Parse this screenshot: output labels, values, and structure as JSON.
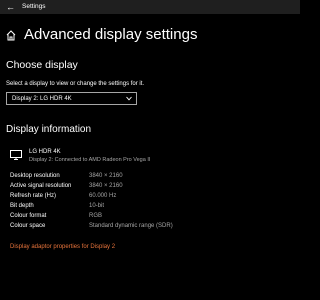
{
  "window": {
    "title": "Settings",
    "back_icon": "back-arrow-icon"
  },
  "header": {
    "home_icon": "home-icon",
    "title": "Advanced display settings"
  },
  "choose_display": {
    "heading": "Choose display",
    "hint": "Select a display to view or change the settings for it.",
    "selected": "Display 2: LG HDR 4K",
    "chevron_icon": "chevron-down-icon"
  },
  "display_information": {
    "heading": "Display information",
    "monitor_icon": "monitor-icon",
    "monitor_name": "LG HDR 4K",
    "connection": "Display 2: Connected to AMD Radeon Pro Vega II",
    "rows": [
      {
        "label": "Desktop resolution",
        "value": "3840 × 2160"
      },
      {
        "label": "Active signal resolution",
        "value": "3840 × 2160"
      },
      {
        "label": "Refresh rate (Hz)",
        "value": "60.000 Hz"
      },
      {
        "label": "Bit depth",
        "value": "10-bit"
      },
      {
        "label": "Colour format",
        "value": "RGB"
      },
      {
        "label": "Colour space",
        "value": "Standard dynamic range (SDR)"
      }
    ],
    "adapter_link": "Display adaptor properties for Display 2"
  },
  "colors": {
    "background": "#000000",
    "titlebar": "#1f1f1f",
    "secondary_text": "#a6a6a6",
    "link_accent": "#e8743b"
  }
}
